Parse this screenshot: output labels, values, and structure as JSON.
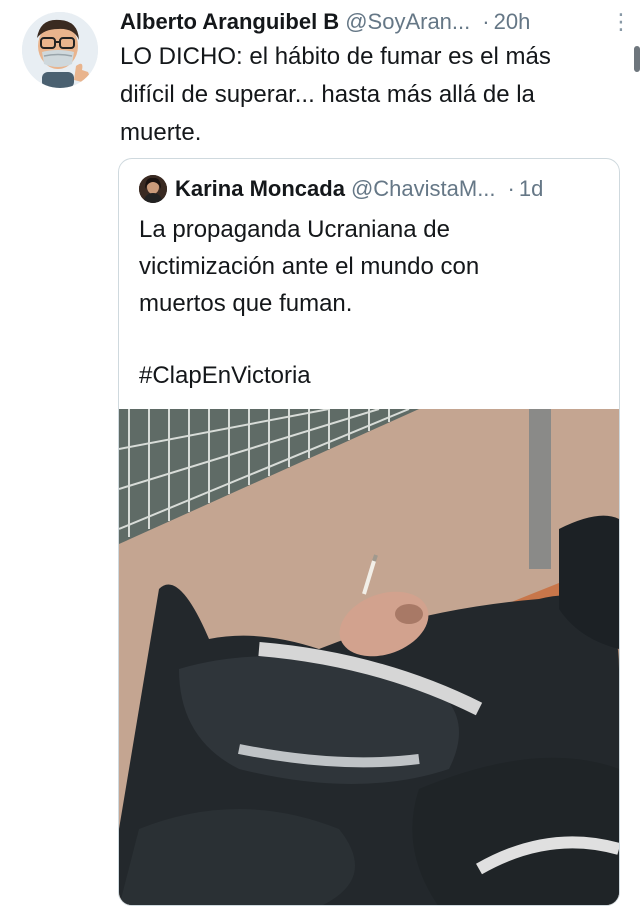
{
  "tweet": {
    "author_name": "Alberto Aranguibel B",
    "author_handle": "@SoyAran...",
    "separator": "·",
    "time": "20h",
    "more_icon": "⋮",
    "text": "LO DICHO: el hábito de fumar es el más\ndifícil de superar... hasta más allá de la\nmuerte."
  },
  "quoted": {
    "author_name": "Karina Moncada",
    "author_handle": "@ChavistaM...",
    "separator": "·",
    "time": "1d",
    "text": "La propaganda Ucraniana de\nvictimización ante el mundo con\nmuertos que fuman.",
    "hashtag": "#ClapEnVictoria"
  }
}
